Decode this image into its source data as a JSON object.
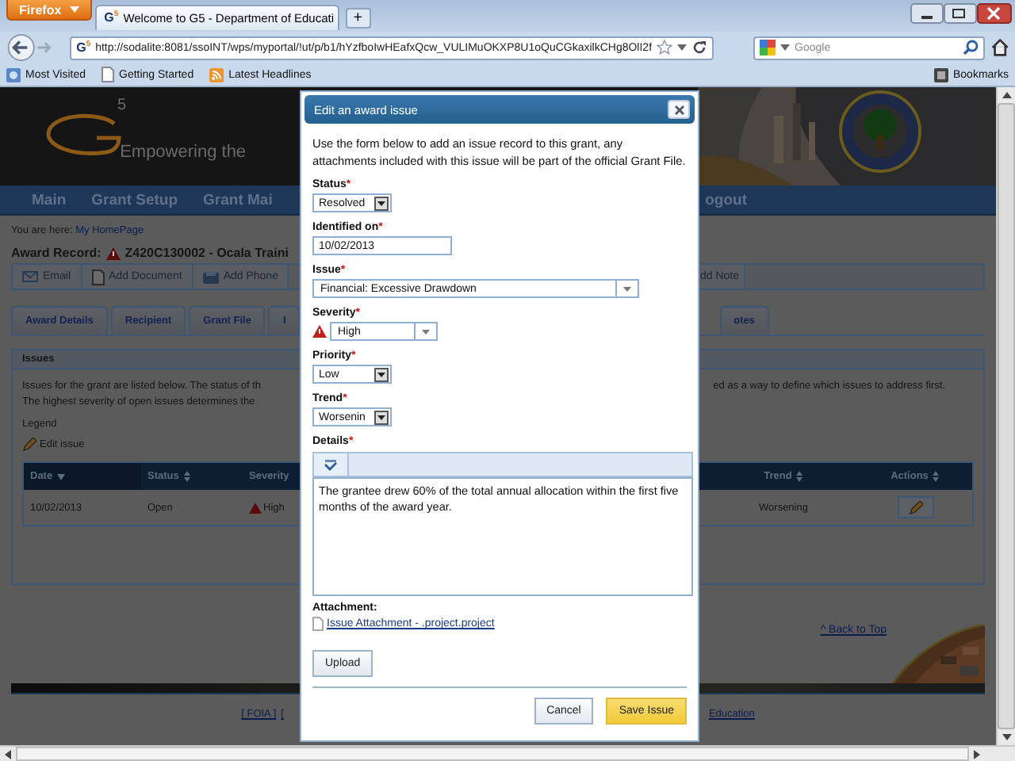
{
  "browser": {
    "menu_button": "Firefox",
    "tab": {
      "favicon": "G",
      "favicon_sup": "5",
      "title": "Welcome to G5 - Department of Educati"
    },
    "new_tab": "+",
    "url_favicon": "G",
    "url_favicon_sup": "5",
    "url": "http://sodalite:8081/ssoINT/wps/myportal/!ut/p/b1/hYzfboIwHEafxQcw_VULIMuOKXP8U1oQuCGkaxilkCHg8OlI2f",
    "search_placeholder": "Google",
    "bookmarks": [
      {
        "label": "Most Visited",
        "kind": "globe"
      },
      {
        "label": "Getting Started",
        "kind": "page"
      },
      {
        "label": "Latest Headlines",
        "kind": "feed"
      }
    ],
    "bookmarks_menu": "Bookmarks"
  },
  "site": {
    "logo_digit": "5",
    "tagline": "Empowering the",
    "nav_left": [
      "Main",
      "Grant Setup",
      "Grant Mai"
    ],
    "nav_right": "ogout",
    "breadcrumb_label": "You are here:",
    "breadcrumb_link": "My HomePage",
    "record_label": "Award Record:",
    "record_value": "Z420C130002 - Ocala Traini",
    "toolbar_left": [
      {
        "label": "Email",
        "kind": "mail"
      },
      {
        "label": "Add Document",
        "kind": "document"
      },
      {
        "label": "Add Phone",
        "kind": "phone"
      }
    ],
    "toolbar_right": "dd Note",
    "tabs_left": [
      "Award Details",
      "Recipient",
      "Grant File",
      "I"
    ],
    "tabs_right": [
      "otes"
    ],
    "panel": {
      "title": "Issues",
      "intro_left": [
        "Issues for the grant are listed below. The status of th",
        "The highest severity of open issues determines the"
      ],
      "intro_right": "ed as a way to define which issues to address first.",
      "legend": "Legend",
      "legend_item": "Edit issue",
      "columns_left": [
        {
          "label": "Date",
          "sorted": true
        },
        {
          "label": "Status",
          "sorted": false
        },
        {
          "label": "Severity"
        }
      ],
      "columns_right": [
        {
          "label": "Trend",
          "sorted": false
        },
        {
          "label": "Actions",
          "sorted": false
        }
      ],
      "rows": [
        {
          "date": "10/02/2013",
          "status": "Open",
          "severity": "High",
          "trend": "Worsening"
        }
      ]
    },
    "back_to_top": "^ Back to Top",
    "footer_links_left": [
      "[ FOIA ]",
      "["
    ],
    "footer_links_right": [
      "Education"
    ]
  },
  "dialog": {
    "title": "Edit an award issue",
    "intro": "Use the form below to add an issue record to this grant, any attachments included with this issue will be part of the official Grant File.",
    "required_mark": "*",
    "fields": [
      {
        "kind": "select",
        "label": "Status",
        "required": true,
        "value": "Resolved"
      },
      {
        "kind": "text",
        "label": "Identified on",
        "required": true,
        "value": "10/02/2013"
      },
      {
        "kind": "combo",
        "label": "Issue",
        "required": true,
        "value": "Financial: Excessive Drawdown",
        "warning": false
      },
      {
        "kind": "combo",
        "label": "Severity",
        "required": true,
        "value": "High",
        "warning": true
      },
      {
        "kind": "select",
        "label": "Priority",
        "required": true,
        "value": "Low"
      },
      {
        "kind": "select",
        "label": "Trend",
        "required": true,
        "value": "Worsenin"
      }
    ],
    "details": {
      "label": "Details",
      "required": true,
      "value": "The grantee drew 60% of the total annual allocation within the first five months of the award year."
    },
    "attachment_label": "Attachment:",
    "attachment_file": "Issue Attachment - .project.project",
    "upload": "Upload",
    "cancel": "Cancel",
    "save": "Save Issue"
  }
}
